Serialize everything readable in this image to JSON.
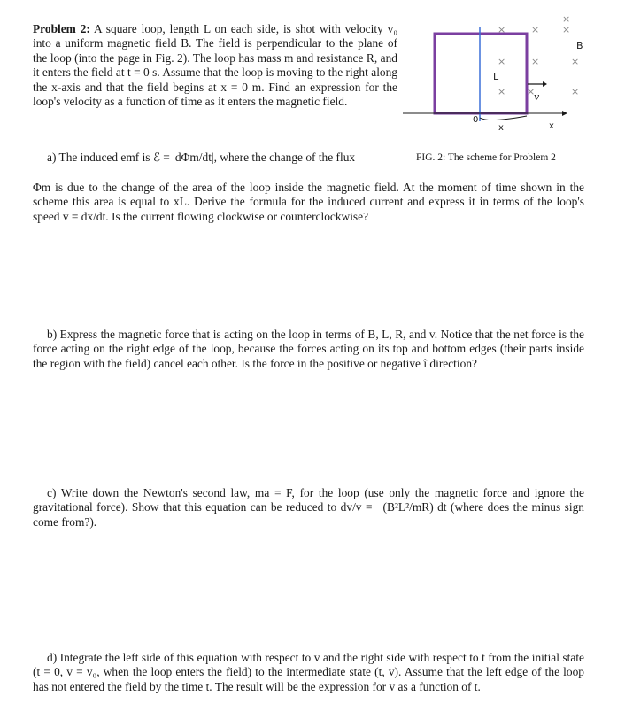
{
  "problem": {
    "heading": "Problem 2:",
    "intro": " A square loop, length L on each side, is shot with velocity v₀ into a uniform magnetic field B. The field is perpendicular to the plane of the loop (into the page in Fig. 2). The loop has mass m and resistance R, and it enters the field at t = 0 s. Assume that the loop is moving to the right along the x-axis and that the field begins at x = 0 m. Find an expression for the loop's velocity as a function of time as it enters the magnetic field."
  },
  "figure": {
    "caption": "FIG. 2: The scheme for Problem 2",
    "labels": {
      "side_length": "L",
      "velocity": "v",
      "field": "B",
      "origin": "0",
      "position": "x",
      "axis": "x"
    },
    "field_marks": [
      "×",
      "×",
      "×",
      "×",
      "×",
      "×",
      "×",
      "×",
      "×",
      "×"
    ],
    "colors": {
      "loop": "#7b3fa0",
      "field_boundary": "#3a6fd8",
      "axis": "#1a1a1a",
      "field_marks": "#888888"
    }
  },
  "parts": {
    "a": {
      "line1": "a) The induced emf is ℰ = |dΦm/dt|, where the change of the flux",
      "rest": "Φm is due to the change of the area of the loop inside the magnetic field. At the moment of time shown in the scheme this area is equal to xL. Derive the formula for the induced current and express it in terms of the loop's speed v = dx/dt. Is the current flowing clockwise or counterclockwise?"
    },
    "b": {
      "text": "b) Express the magnetic force that is acting on the loop in terms of B, L, R, and v. Notice that the net force is the force acting on the right edge of the loop, because the forces acting on its top and bottom edges (their parts inside the region with the field) cancel each other. Is the force in the positive or negative î direction?"
    },
    "c": {
      "text": "c) Write down the Newton's second law, ma = F, for the loop (use only the magnetic force and ignore the gravitational force). Show that this equation can be reduced to dv/v = −(B²L²/mR) dt (where does the minus sign come from?)."
    },
    "d": {
      "text": "d) Integrate the left side of this equation with respect to v and the right side with respect to t from the initial state (t = 0, v = v₀, when the loop enters the field) to the intermediate state (t, v). Assume that the left edge of the loop has not entered the field by the time t. The result will be the expression for v as a function of t."
    }
  }
}
